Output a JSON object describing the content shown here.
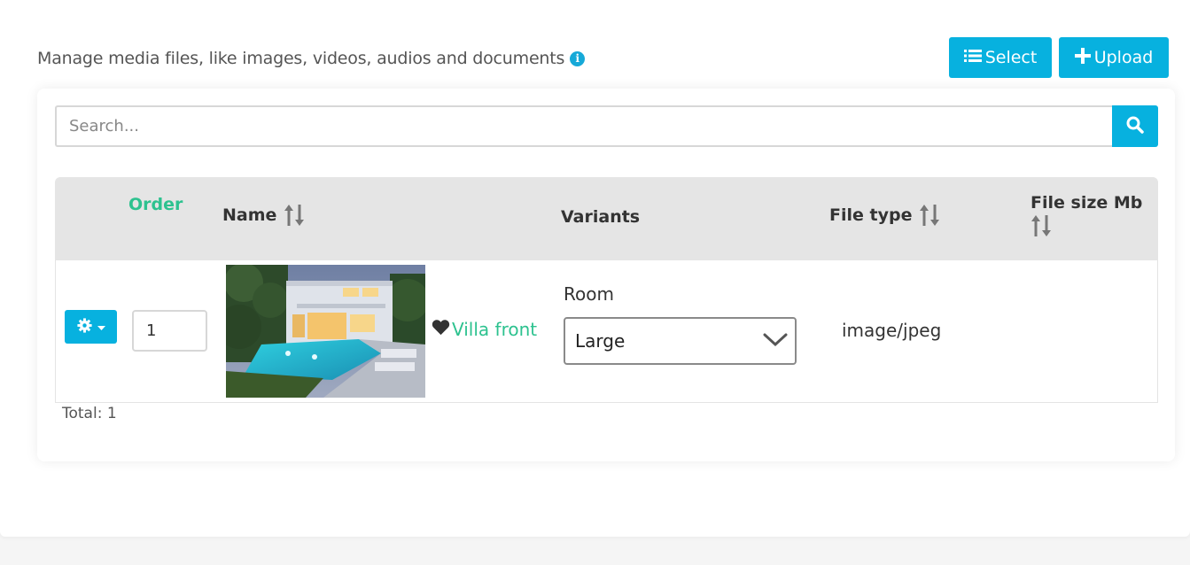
{
  "header": {
    "description": "Manage media files, like images, videos, audios and documents",
    "select_label": "Select",
    "upload_label": "Upload"
  },
  "search": {
    "placeholder": "Search...",
    "value": ""
  },
  "table": {
    "columns": {
      "order": "Order",
      "name": "Name",
      "variants": "Variants",
      "file_type": "File type",
      "file_size": "File size Mb"
    },
    "rows": [
      {
        "order": "1",
        "name": "Villa front",
        "variant_group": "Room",
        "variant_selected": "Large",
        "file_type": "image/jpeg",
        "file_size": ""
      }
    ]
  },
  "footer": {
    "total": "Total: 1"
  },
  "colors": {
    "accent": "#07b1df",
    "green": "#2dc28f",
    "header_bg": "#e5e5e5"
  },
  "icons": [
    "info-icon",
    "list-icon",
    "plus-icon",
    "search-icon",
    "sort-icon",
    "gear-icon",
    "caret-down-icon",
    "heart-icon",
    "chevron-down-icon"
  ]
}
